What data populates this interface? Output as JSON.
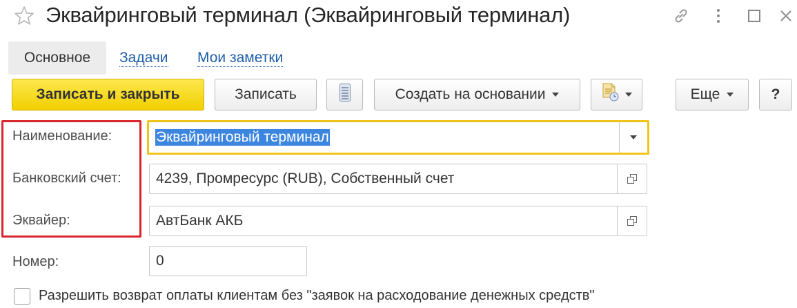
{
  "window": {
    "title": "Эквайринговый терминал (Эквайринговый терминал)",
    "icons": [
      "star-icon",
      "link-icon",
      "more-vertical-icon",
      "maximize-icon",
      "close-icon"
    ]
  },
  "tabs": [
    {
      "label": "Основное",
      "active": true
    },
    {
      "label": "Задачи",
      "active": false
    },
    {
      "label": "Мои заметки",
      "active": false
    }
  ],
  "toolbar": {
    "save_close_label": "Записать и закрыть",
    "save_label": "Записать",
    "list_icon": "list-icon",
    "create_based_label": "Создать на основании",
    "print_icon": "document-print-icon",
    "more_label": "Еще",
    "help_label": "?"
  },
  "form": {
    "name_label": "Наименование:",
    "name_value": "Эквайринговый терминал",
    "bank_account_label": "Банковский счет:",
    "bank_account_value": "4239, Промресурс (RUB), Собственный счет",
    "acquirer_label": "Эквайер:",
    "acquirer_value": "АвтБанк АКБ",
    "number_label": "Номер:",
    "number_value": "0",
    "refund_checkbox_label": "Разрешить возврат оплаты клиентам без \"заявок на расходование денежных средств\"",
    "refund_checked": false
  },
  "colors": {
    "primary_button": "#f6dc1b",
    "link": "#1f5fa8",
    "highlight_border": "#d8262c",
    "focus_border": "#f0c419",
    "selection": "#3d86e0"
  }
}
